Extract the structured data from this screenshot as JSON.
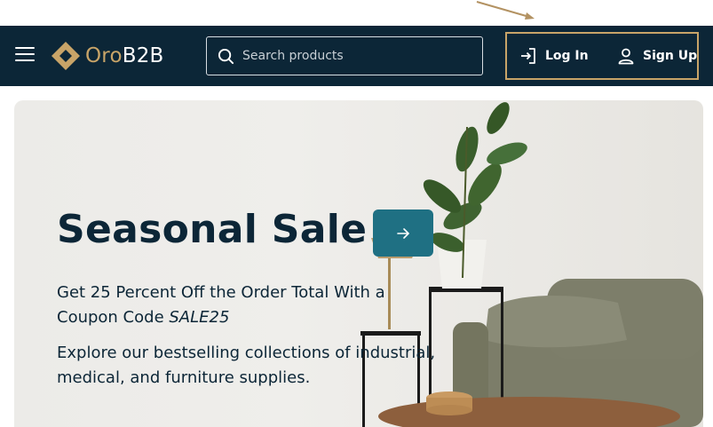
{
  "header": {
    "logo": {
      "prefix": "Oro",
      "suffix": "B2B"
    },
    "search": {
      "placeholder": "Search products",
      "value": ""
    },
    "login_label": "Log In",
    "signup_label": "Sign Up"
  },
  "hero": {
    "title": "Seasonal Sale",
    "offer_text": "Get 25 Percent Off the Order Total With a Coupon Code",
    "coupon_code": "SALE25",
    "explore_text": "Explore our bestselling collections of industrial, medical, and furniture supplies."
  },
  "colors": {
    "header_bg": "#0c2637",
    "accent_gold": "#c8a468",
    "cta_teal": "#1f7083",
    "text_dark": "#0c2637"
  },
  "icons": [
    "menu-icon",
    "logo-icon",
    "search-icon",
    "login-icon",
    "user-icon",
    "arrow-right-icon"
  ]
}
